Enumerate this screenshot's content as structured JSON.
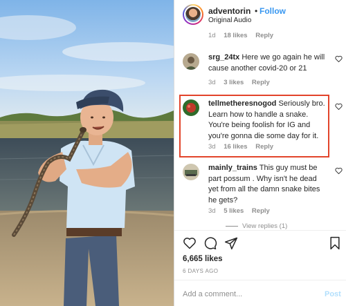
{
  "post": {
    "username": "adventorin",
    "separator": "•",
    "follow_label": "Follow",
    "audio": "Original Audio"
  },
  "top_comment_meta": {
    "age": "1d",
    "likes": "18 likes",
    "reply": "Reply"
  },
  "comments": [
    {
      "username": "srg_24tx",
      "text": "Here we go again he will cause another covid-20 or 21",
      "age": "3d",
      "likes": "3 likes",
      "reply": "Reply"
    },
    {
      "username": "tellmetheresnogod",
      "text": "Seriously bro. Learn how to handle a snake. You're being foolish for IG and you're gonna die some day for it.",
      "age": "3d",
      "likes": "16 likes",
      "reply": "Reply"
    },
    {
      "username": "mainly_trains",
      "text": "This guy must be part possum . Why isn't he dead yet from all the damn snake bites he gets?",
      "age": "3d",
      "likes": "5 likes",
      "reply": "Reply"
    }
  ],
  "view_replies": "View replies (1)",
  "likes_count": "6,665 likes",
  "time_ago": "6 DAYS AGO",
  "add_comment_placeholder": "Add a comment...",
  "post_label": "Post",
  "colors": {
    "accent": "#3897f0",
    "highlight": "#e2432a",
    "muted": "#8e8e8e",
    "post_disabled": "#b2dffc"
  },
  "icons": [
    "heart-icon",
    "comment-icon",
    "share-icon",
    "bookmark-icon"
  ]
}
